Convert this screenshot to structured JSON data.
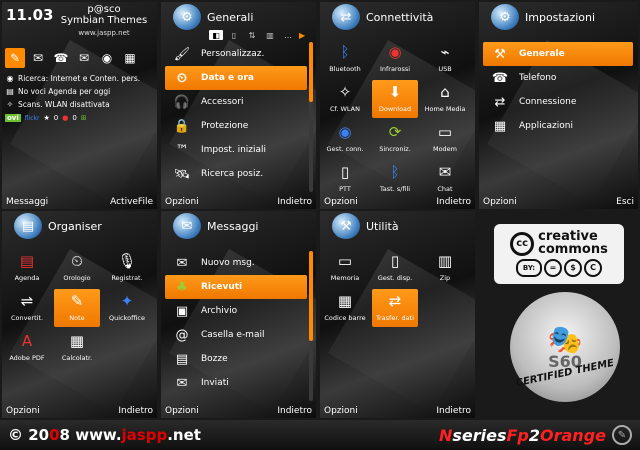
{
  "home": {
    "clock": "11.03",
    "brand_line1": "p@sco",
    "brand_line2": "Symbian Themes",
    "url": "www.jaspp.net",
    "info": [
      {
        "icon": "globe",
        "text": "Ricerca: Internet e Conten. pers."
      },
      {
        "icon": "calendar",
        "text": "No voci Agenda per oggi"
      },
      {
        "icon": "wlan",
        "text": "Scans. WLAN disattivata"
      }
    ],
    "apps_ovi": "ovi",
    "apps_flickr": "flickr",
    "counter1": "0",
    "counter2": "0",
    "soft_left": "Messaggi",
    "soft_right": "ActiveFile"
  },
  "generali": {
    "title": "Generali",
    "items": [
      {
        "label": "Personalizzaz.",
        "icon": "brush"
      },
      {
        "label": "Data e ora",
        "icon": "clock"
      },
      {
        "label": "Accessori",
        "icon": "headset"
      },
      {
        "label": "Protezione",
        "icon": "lock"
      },
      {
        "label": "Impost. iniziali",
        "icon": "tm"
      },
      {
        "label": "Ricerca posiz.",
        "icon": "satellite"
      }
    ],
    "soft_left": "Opzioni",
    "soft_right": "Indietro"
  },
  "connettivita": {
    "title": "Connettività",
    "items": [
      {
        "label": "Bluetooth",
        "icon": "bluetooth"
      },
      {
        "label": "Infrarossi",
        "icon": "infrared"
      },
      {
        "label": "USB",
        "icon": "usb"
      },
      {
        "label": "Cf. WLAN",
        "icon": "wlan"
      },
      {
        "label": "Download",
        "icon": "download"
      },
      {
        "label": "Home Media",
        "icon": "home"
      },
      {
        "label": "Gest. conn.",
        "icon": "globe"
      },
      {
        "label": "Sincroniz.",
        "icon": "sync"
      },
      {
        "label": "Modem",
        "icon": "modem"
      },
      {
        "label": "PTT",
        "icon": "ptt"
      },
      {
        "label": "Tast. s/fili",
        "icon": "bluetooth"
      },
      {
        "label": "Chat",
        "icon": "chat"
      }
    ],
    "soft_left": "Opzioni",
    "soft_right": "Indietro"
  },
  "impostazioni": {
    "title": "Impostazioni",
    "items": [
      {
        "label": "Generale",
        "icon": "tools"
      },
      {
        "label": "Telefono",
        "icon": "phone"
      },
      {
        "label": "Connessione",
        "icon": "connection"
      },
      {
        "label": "Applicazioni",
        "icon": "apps"
      }
    ],
    "soft_left": "Opzioni",
    "soft_right": "Esci"
  },
  "organiser": {
    "title": "Organiser",
    "items": [
      {
        "label": "Agenda",
        "icon": "calendar"
      },
      {
        "label": "Orologio",
        "icon": "clock"
      },
      {
        "label": "Registrat.",
        "icon": "mic"
      },
      {
        "label": "Convertit.",
        "icon": "converter"
      },
      {
        "label": "Note",
        "icon": "pencil"
      },
      {
        "label": "Quickoffice",
        "icon": "office"
      },
      {
        "label": "Adobe PDF",
        "icon": "pdf"
      },
      {
        "label": "Calcolatr.",
        "icon": "calculator"
      }
    ],
    "soft_left": "Opzioni",
    "soft_right": "Indietro"
  },
  "messaggi": {
    "title": "Messaggi",
    "items": [
      {
        "label": "Nuovo msg.",
        "icon": "envelope"
      },
      {
        "label": "Ricevuti",
        "icon": "inbox"
      },
      {
        "label": "Archivio",
        "icon": "archive"
      },
      {
        "label": "Casella e-mail",
        "icon": "mail"
      },
      {
        "label": "Bozze",
        "icon": "draft"
      },
      {
        "label": "Inviati",
        "icon": "sent"
      }
    ],
    "soft_left": "Opzioni",
    "soft_right": "Indietro"
  },
  "utilita": {
    "title": "Utilità",
    "items": [
      {
        "label": "Memoria",
        "icon": "memory"
      },
      {
        "label": "Gest. disp.",
        "icon": "device"
      },
      {
        "label": "Zip",
        "icon": "zip"
      },
      {
        "label": "Codice barre",
        "icon": "barcode"
      },
      {
        "label": "Trasfer. dati",
        "icon": "transfer"
      }
    ],
    "soft_left": "Opzioni",
    "soft_right": "Indietro"
  },
  "badges": {
    "cc_logo": "cc",
    "cc_text1": "creative",
    "cc_text2": "commons",
    "cc_by": "BY:",
    "cc_eq": "=",
    "cc_dollar": "$",
    "cc_c": "C",
    "s60_text": "S60",
    "certified": "CERTIFIED THEME"
  },
  "footer": {
    "copyright_a": "© 20",
    "copyright_b": "0",
    "copyright_c": "8 www.",
    "copyright_d": "jaspp",
    "copyright_e": ".net",
    "brand_n": "N",
    "brand_series": "series",
    "brand_fp": "Fp",
    "brand_2": "2",
    "brand_orange": "Orange"
  },
  "colors": {
    "accent": "#ff8a00",
    "background": "#1a1a1a"
  }
}
